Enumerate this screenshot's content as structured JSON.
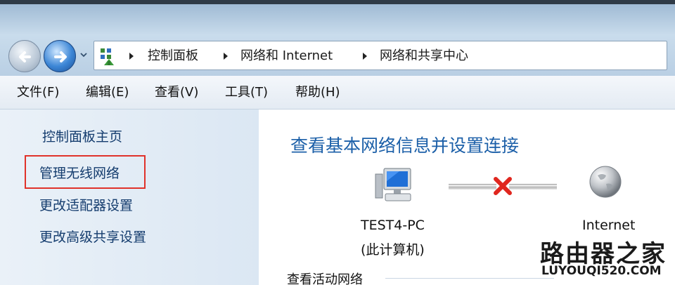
{
  "address_bar": {
    "breadcrumbs": [
      "控制面板",
      "网络和 Internet",
      "网络和共享中心"
    ]
  },
  "menu": {
    "items": [
      "文件(F)",
      "编辑(E)",
      "查看(V)",
      "工具(T)",
      "帮助(H)"
    ]
  },
  "sidebar": {
    "home": "控制面板主页",
    "links": [
      "管理无线网络",
      "更改适配器设置",
      "更改高级共享设置"
    ]
  },
  "main": {
    "title": "查看基本网络信息并设置连接",
    "computer_name": "TEST4-PC",
    "computer_sub": "(此计算机)",
    "internet_label": "Internet",
    "active_networks_label": "查看活动网络"
  },
  "watermark": {
    "title": "路由器之家",
    "url": "LUYOUQI520.COM"
  },
  "colors": {
    "link": "#143c6e",
    "title": "#1b5fa8",
    "highlight": "#e0322a",
    "disconnect": "#e0261e"
  }
}
